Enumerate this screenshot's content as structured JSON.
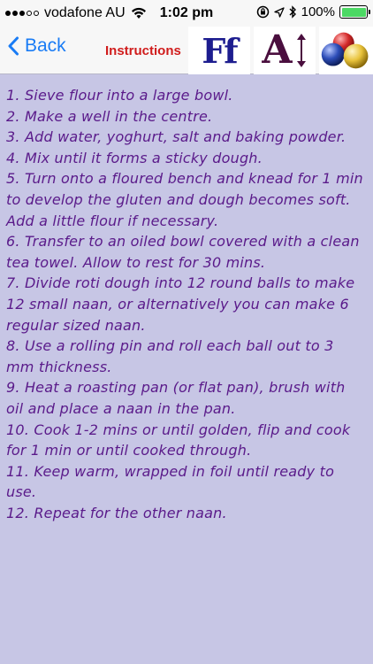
{
  "status_bar": {
    "carrier": "vodafone AU",
    "time": "1:02 pm",
    "battery": "100%"
  },
  "nav": {
    "back_label": "Back",
    "title": "Instructions",
    "font_button": "Ff",
    "size_button": "A"
  },
  "instructions": [
    "1. Sieve flour into a large bowl.",
    "2. Make a well in the centre.",
    "3. Add water, yoghurt, salt and baking powder.",
    "4. Mix until it forms a sticky dough.",
    "5. Turn onto a floured bench and knead for 1 min to develop the gluten and dough becomes soft. Add a little flour if necessary.",
    "6. Transfer to an oiled bowl covered with a clean tea towel. Allow to rest for 30 mins.",
    "7. Divide roti dough into 12 round balls to make 12 small naan, or alternatively you can make 6 regular sized naan.",
    "8. Use a rolling pin and roll each ball out to 3 mm thickness.",
    "9. Heat a roasting pan (or flat pan), brush with oil and place a naan in the pan.",
    "10. Cook 1-2 mins or until golden, flip and cook for 1 min or until cooked through.",
    "11. Keep warm, wrapped in foil until ready to use.",
    "12. Repeat for the other naan."
  ],
  "colors": {
    "content_background": "#c7c6e5",
    "instruction_text": "#5a1a8a",
    "back_button": "#1a7cf5",
    "title": "#d01c1c"
  }
}
